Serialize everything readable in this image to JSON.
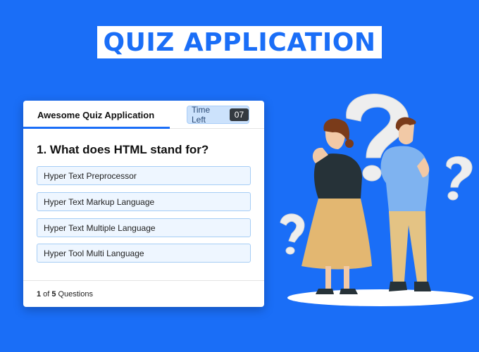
{
  "banner": {
    "title": "QUIZ APPLICATION"
  },
  "quiz": {
    "title": "Awesome Quiz Application",
    "timer_label": "Time Left",
    "timer_value": "07",
    "question": "1. What does HTML stand for?",
    "options": [
      "Hyper Text Preprocessor",
      "Hyper Text Markup Language",
      "Hyper Text Multiple Language",
      "Hyper Tool Multi Language"
    ],
    "footer": {
      "current": "1",
      "of_text": "of",
      "total": "5",
      "suffix": "Questions"
    }
  },
  "colors": {
    "background": "#1a6ef7",
    "accent": "#1a6ef7",
    "option_bg": "#eef6ff"
  },
  "illustration": {
    "icons": [
      "question-mark-icon",
      "woman-thinking",
      "man-thinking"
    ]
  }
}
